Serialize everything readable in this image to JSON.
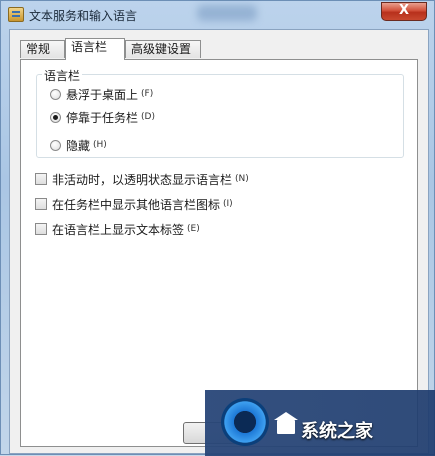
{
  "window": {
    "title": "文本服务和输入语言",
    "close_glyph": "X"
  },
  "tabs": [
    {
      "label": "常规",
      "active": false
    },
    {
      "label": "语言栏",
      "active": true
    },
    {
      "label": "高级键设置",
      "active": false
    }
  ],
  "language_bar": {
    "group_title": "语言栏",
    "options": [
      {
        "label": "悬浮于桌面上",
        "accel": "(F)",
        "checked": false
      },
      {
        "label": "停靠于任务栏",
        "accel": "(D)",
        "checked": true
      },
      {
        "label": "隐藏",
        "accel": "(H)",
        "checked": false
      }
    ]
  },
  "checkboxes": [
    {
      "label": "非活动时，以透明状态显示语言栏",
      "accel": "(N)",
      "checked": false
    },
    {
      "label": "在任务栏中显示其他语言栏图标",
      "accel": "(I)",
      "checked": false
    },
    {
      "label": "在语言栏上显示文本标签",
      "accel": "(E)",
      "checked": false
    }
  ],
  "watermark": {
    "text": "系统之家"
  }
}
